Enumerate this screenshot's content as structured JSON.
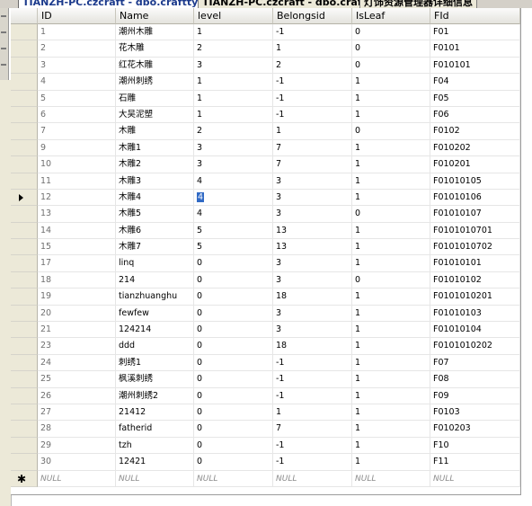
{
  "tabs": [
    {
      "label": "TIANZH-PC.czcraft - dbo.crafttype",
      "active": true
    },
    {
      "label": "TIANZH-PC.czcraft - dbo.crafttype",
      "active": false
    },
    {
      "label": "灯饰资源管理器详细信息",
      "active": false
    }
  ],
  "grid": {
    "columns": [
      "ID",
      "Name",
      "level",
      "Belongsid",
      "IsLeaf",
      "FId"
    ],
    "current_row_index": 10,
    "current_row_icon": "current-row-arrow-icon",
    "new_row_icon": "new-row-asterisk-icon",
    "rows": [
      [
        "1",
        "潮州木雕",
        "1",
        "-1",
        "0",
        "F01"
      ],
      [
        "2",
        "花木雕",
        "2",
        "1",
        "0",
        "F0101"
      ],
      [
        "3",
        "红花木雕",
        "3",
        "2",
        "0",
        "F010101"
      ],
      [
        "4",
        "潮州刺绣",
        "1",
        "-1",
        "1",
        "F04"
      ],
      [
        "5",
        "石雕",
        "1",
        "-1",
        "1",
        "F05"
      ],
      [
        "6",
        "大吴泥塑",
        "1",
        "-1",
        "1",
        "F06"
      ],
      [
        "7",
        "木雕",
        "2",
        "1",
        "0",
        "F0102"
      ],
      [
        "9",
        "木雕1",
        "3",
        "7",
        "1",
        "F010202"
      ],
      [
        "10",
        "木雕2",
        "3",
        "7",
        "1",
        "F010201"
      ],
      [
        "11",
        "木雕3",
        "4",
        "3",
        "1",
        "F01010105"
      ],
      [
        "12",
        "木雕4",
        "4",
        "3",
        "1",
        "F01010106"
      ],
      [
        "13",
        "木雕5",
        "4",
        "3",
        "0",
        "F01010107"
      ],
      [
        "14",
        "木雕6",
        "5",
        "13",
        "1",
        "F0101010701"
      ],
      [
        "15",
        "木雕7",
        "5",
        "13",
        "1",
        "F0101010702"
      ],
      [
        "17",
        "linq",
        "0",
        "3",
        "1",
        "F01010101"
      ],
      [
        "18",
        "214",
        "0",
        "3",
        "0",
        "F01010102"
      ],
      [
        "19",
        "tianzhuanghu",
        "0",
        "18",
        "1",
        "F0101010201"
      ],
      [
        "20",
        "fewfew",
        "0",
        "3",
        "1",
        "F01010103"
      ],
      [
        "21",
        "124214",
        "0",
        "3",
        "1",
        "F01010104"
      ],
      [
        "23",
        "ddd",
        "0",
        "18",
        "1",
        "F0101010202"
      ],
      [
        "24",
        "刺绣1",
        "0",
        "-1",
        "1",
        "F07"
      ],
      [
        "25",
        "枫溪刺绣",
        "0",
        "-1",
        "1",
        "F08"
      ],
      [
        "26",
        "潮州刺绣2",
        "0",
        "-1",
        "1",
        "F09"
      ],
      [
        "27",
        "21412",
        "0",
        "1",
        "1",
        "F0103"
      ],
      [
        "28",
        "fatherid",
        "0",
        "7",
        "1",
        "F010203"
      ],
      [
        "29",
        "tzh",
        "0",
        "-1",
        "1",
        "F10"
      ],
      [
        "30",
        "12421",
        "0",
        "-1",
        "1",
        "F11"
      ]
    ],
    "new_row": [
      "NULL",
      "NULL",
      "NULL",
      "NULL",
      "NULL",
      "NULL"
    ]
  }
}
